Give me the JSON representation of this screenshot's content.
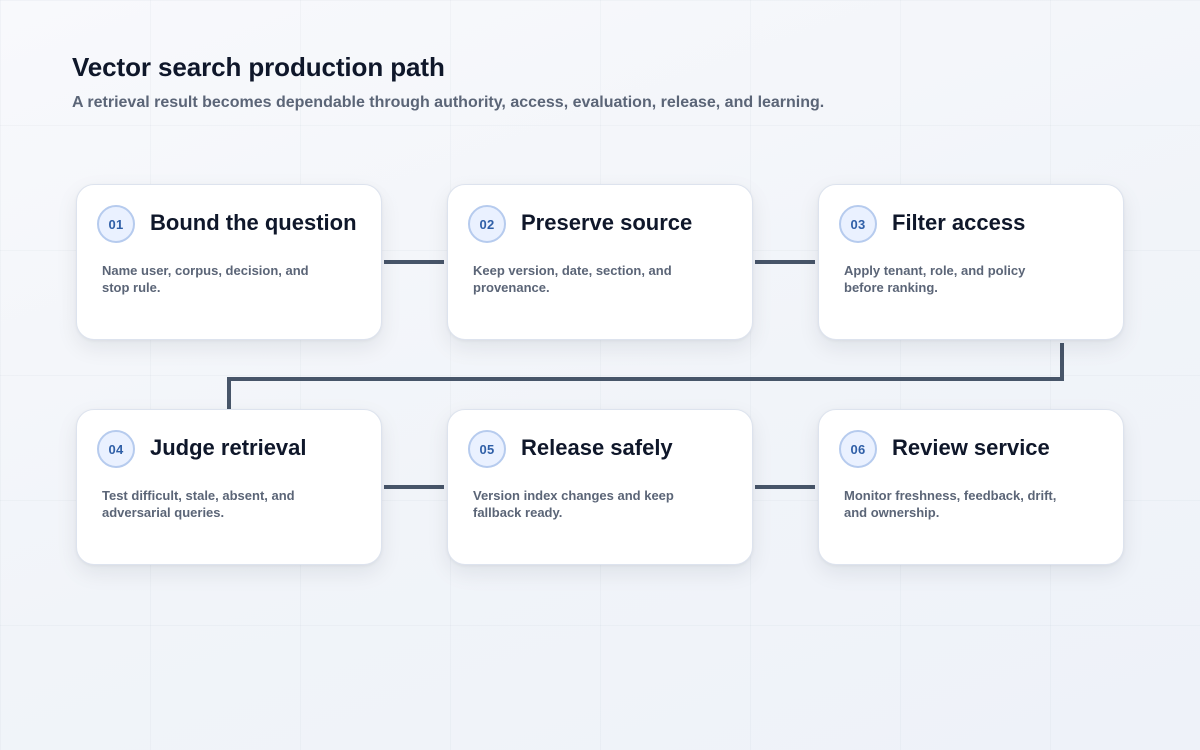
{
  "header": {
    "title": "Vector search production path",
    "subtitle": "A retrieval result becomes dependable through authority, access, evaluation, release, and learning."
  },
  "steps": [
    {
      "number": "01",
      "title": "Bound the question",
      "description": "Name user, corpus, decision, and stop rule."
    },
    {
      "number": "02",
      "title": "Preserve source",
      "description": "Keep version, date, section, and provenance."
    },
    {
      "number": "03",
      "title": "Filter access",
      "description": "Apply tenant, role, and policy before ranking."
    },
    {
      "number": "04",
      "title": "Judge retrieval",
      "description": "Test difficult, stale, absent, and adversarial queries."
    },
    {
      "number": "05",
      "title": "Release safely",
      "description": "Version index changes and keep fallback ready."
    },
    {
      "number": "06",
      "title": "Review service",
      "description": "Monitor freshness, feedback, drift, and ownership."
    }
  ],
  "colors": {
    "connector": "#475569",
    "badge_text": "#2f5fa7",
    "badge_border": "#b6cbee",
    "title": "#0f172a",
    "muted_text": "#5b6577"
  }
}
